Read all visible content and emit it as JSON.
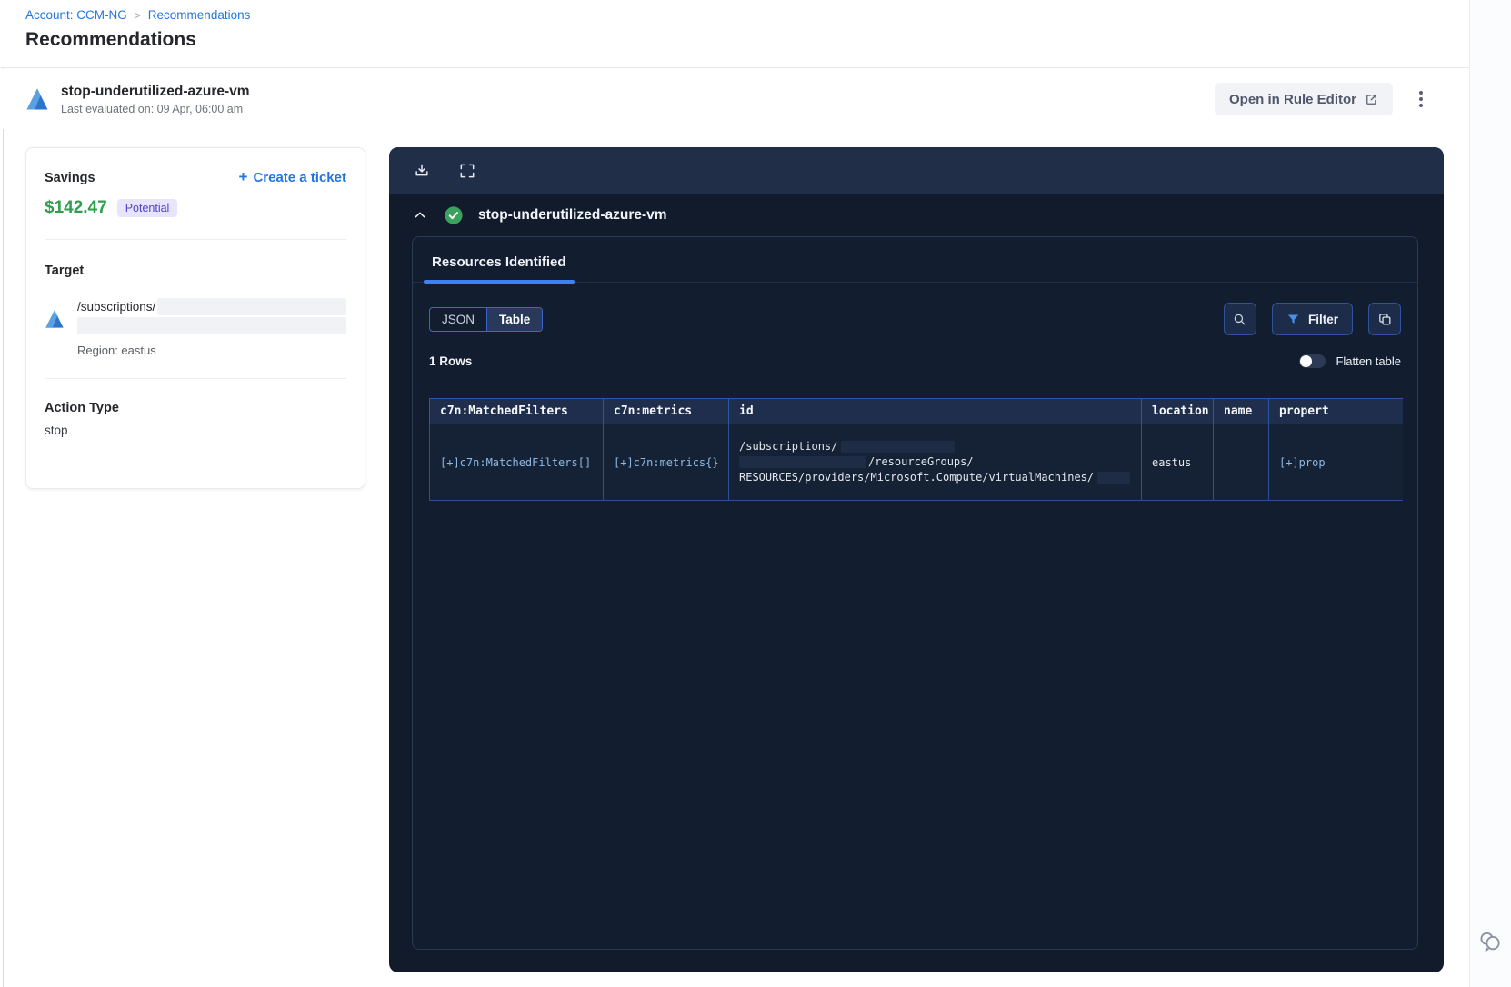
{
  "breadcrumb": {
    "account_link": "Account: CCM-NG",
    "separator": ">",
    "current_link": "Recommendations"
  },
  "page_title": "Recommendations",
  "rule_header": {
    "title": "stop-underutilized-azure-vm",
    "subtitle": "Last evaluated on: 09 Apr, 06:00 am",
    "open_button": "Open in Rule Editor"
  },
  "savings_card": {
    "savings_label": "Savings",
    "amount": "$142.47",
    "badge": "Potential",
    "plus": "+",
    "create_ticket_label": "Create a ticket",
    "target_label": "Target",
    "target_path": "/subscriptions/",
    "region": "Region: eastus",
    "action_type_label": "Action Type",
    "action_type": "stop"
  },
  "panel": {
    "rule_title": "stop-underutilized-azure-vm",
    "tab_label": "Resources Identified",
    "segmented": {
      "json": "JSON",
      "table": "Table",
      "active": "Table"
    },
    "filter_button": "Filter",
    "rows_count": "1 Rows",
    "flatten_toggle_label": "Flatten table",
    "flatten_toggle_state": "off",
    "table": {
      "columns": [
        "c7n:MatchedFilters",
        "c7n:metrics",
        "id",
        "location",
        "name",
        "propert"
      ],
      "row": {
        "matched_filters": "[+]c7n:MatchedFilters[]",
        "metrics": "[+]c7n:metrics{}",
        "id_line_1": "/subscriptions/",
        "id_line_2": "/resourceGroups/",
        "id_line_3": "RESOURCES/providers/Microsoft.Compute/virtualMachines/",
        "location": "eastus",
        "name": "",
        "properties": "[+]prop"
      }
    }
  },
  "icons": {
    "azure": "azure-logo",
    "breadcrumb_separator": ">",
    "kebab": "vertical-dots",
    "external_link": "open-in-new",
    "download": "download-tray",
    "fullscreen": "expand-corners",
    "collapse": "chevron-up",
    "status": "check-circle",
    "search": "magnifier",
    "filter": "funnel",
    "copy": "copy-squares",
    "chat": "chat-bubbles"
  },
  "colors": {
    "accent_blue": "#2276e0",
    "savings_green": "#2f9e4f",
    "badge_bg": "#e7e4fb",
    "badge_text": "#4e44c8",
    "panel_bg": "#111b2c",
    "toolbar_bg": "#202e47",
    "table_border": "#2f56a3",
    "cell_link_blue": "#8fb9e3",
    "success_green": "#3aa25c",
    "tab_underline": "#3b82f6"
  }
}
